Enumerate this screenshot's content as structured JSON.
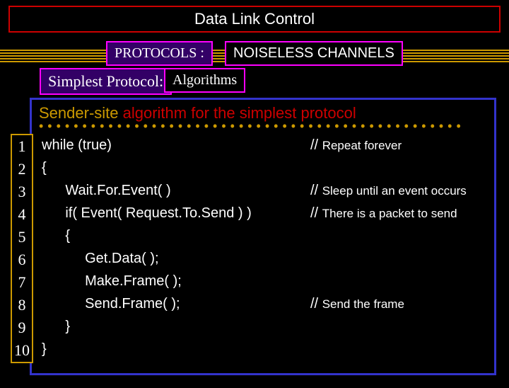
{
  "title": "Data Link Control",
  "protocols_label": "PROTOCOLS :",
  "noiseless_label": "NOISELESS CHANNELS",
  "simplest_label": "Simplest Protocol:",
  "algorithms_label": "Algorithms",
  "heading_part1": "Sender-site ",
  "heading_part2": "algorithm for the simplest protocol",
  "line_numbers": [
    "1",
    "2",
    "3",
    "4",
    "5",
    "6",
    "7",
    "8",
    "9",
    "10"
  ],
  "code": {
    "l1": "while (true)",
    "l2": "{",
    "l3": "      Wait.For.Event( )",
    "l4": "      if( Event( Request.To.Send ) )",
    "l5": "      {",
    "l6": "           Get.Data( );",
    "l7": "           Make.Frame( );",
    "l8": "           Send.Frame( );",
    "l9": "      }",
    "l10": "}"
  },
  "comments": {
    "c1": "Repeat forever",
    "c3": "Sleep until an event occurs",
    "c4": "There is a packet to send",
    "c8": "Send the frame"
  },
  "slashes": "//"
}
